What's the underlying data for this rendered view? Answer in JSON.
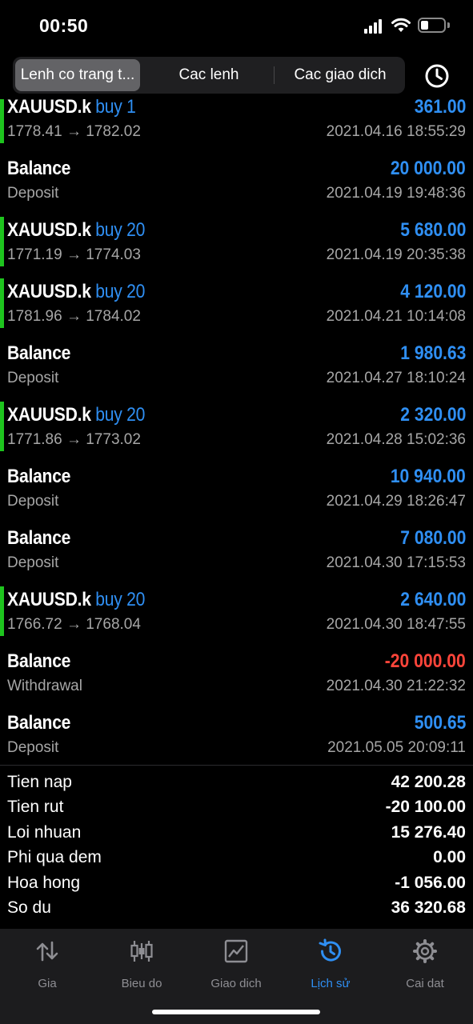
{
  "status": {
    "time": "00:50"
  },
  "tabs": [
    {
      "label": "Lenh co trang t..."
    },
    {
      "label": "Cac lenh"
    },
    {
      "label": "Cac giao dich"
    }
  ],
  "rows": [
    {
      "kind": "trade",
      "symbol": "XAUUSD.k",
      "side": "buy 1",
      "detail": "1778.41 → 1782.02",
      "amount": "361.00",
      "time": "2021.04.16 18:55:29",
      "negative": false
    },
    {
      "kind": "balance",
      "symbol": "Balance",
      "side": "",
      "detail": "Deposit",
      "amount": "20 000.00",
      "time": "2021.04.19 19:48:36",
      "negative": false
    },
    {
      "kind": "trade",
      "symbol": "XAUUSD.k",
      "side": "buy 20",
      "detail": "1771.19 → 1774.03",
      "amount": "5 680.00",
      "time": "2021.04.19 20:35:38",
      "negative": false
    },
    {
      "kind": "trade",
      "symbol": "XAUUSD.k",
      "side": "buy 20",
      "detail": "1781.96 → 1784.02",
      "amount": "4 120.00",
      "time": "2021.04.21 10:14:08",
      "negative": false
    },
    {
      "kind": "balance",
      "symbol": "Balance",
      "side": "",
      "detail": "Deposit",
      "amount": "1 980.63",
      "time": "2021.04.27 18:10:24",
      "negative": false
    },
    {
      "kind": "trade",
      "symbol": "XAUUSD.k",
      "side": "buy 20",
      "detail": "1771.86 → 1773.02",
      "amount": "2 320.00",
      "time": "2021.04.28 15:02:36",
      "negative": false
    },
    {
      "kind": "balance",
      "symbol": "Balance",
      "side": "",
      "detail": "Deposit",
      "amount": "10 940.00",
      "time": "2021.04.29 18:26:47",
      "negative": false
    },
    {
      "kind": "balance",
      "symbol": "Balance",
      "side": "",
      "detail": "Deposit",
      "amount": "7 080.00",
      "time": "2021.04.30 17:15:53",
      "negative": false
    },
    {
      "kind": "trade",
      "symbol": "XAUUSD.k",
      "side": "buy 20",
      "detail": "1766.72 → 1768.04",
      "amount": "2 640.00",
      "time": "2021.04.30 18:47:55",
      "negative": false
    },
    {
      "kind": "balance",
      "symbol": "Balance",
      "side": "",
      "detail": "Withdrawal",
      "amount": "-20 000.00",
      "time": "2021.04.30 21:22:32",
      "negative": true
    },
    {
      "kind": "balance",
      "symbol": "Balance",
      "side": "",
      "detail": "Deposit",
      "amount": "500.65",
      "time": "2021.05.05 20:09:11",
      "negative": false
    }
  ],
  "summary": [
    {
      "label": "Tien nap",
      "value": "42 200.28"
    },
    {
      "label": "Tien rut",
      "value": "-20 100.00"
    },
    {
      "label": "Loi nhuan",
      "value": "15 276.40"
    },
    {
      "label": "Phi qua dem",
      "value": "0.00"
    },
    {
      "label": "Hoa hong",
      "value": "-1 056.00"
    },
    {
      "label": "So du",
      "value": "36 320.68"
    }
  ],
  "tabbar": [
    {
      "label": "Gia",
      "icon": "quotes-arrows-icon",
      "active": false
    },
    {
      "label": "Bieu do",
      "icon": "candlestick-chart-icon",
      "active": false
    },
    {
      "label": "Giao dich",
      "icon": "trade-chart-icon",
      "active": false
    },
    {
      "label": "Lịch sử",
      "icon": "history-clock-icon",
      "active": true
    },
    {
      "label": "Cai dat",
      "icon": "gear-icon",
      "active": false
    }
  ],
  "colors": {
    "accent": "#2f8ff3",
    "negative": "#ff453a",
    "buy_bar": "#1ec41e",
    "background": "#000000"
  }
}
